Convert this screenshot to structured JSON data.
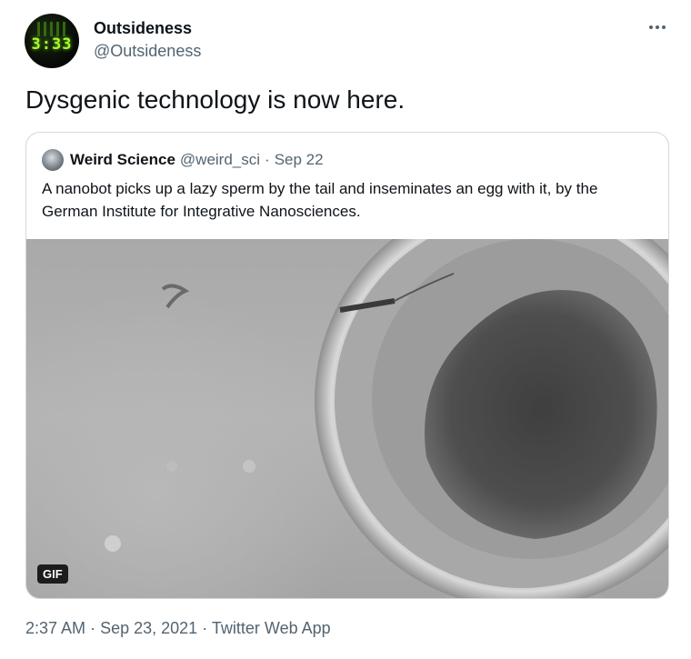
{
  "author": {
    "display_name": "Outsideness",
    "handle": "@Outsideness",
    "avatar_text": "3:33"
  },
  "tweet": {
    "text": "Dysgenic technology is now here."
  },
  "quoted_tweet": {
    "display_name": "Weird Science",
    "handle": "@weird_sci",
    "separator": "·",
    "date": "Sep 22",
    "text": "A nanobot picks up a lazy sperm by the tail and inseminates an egg with it, by the German Institute for Integrative Nanosciences.",
    "media_badge": "GIF"
  },
  "footer": {
    "time": "2:37 AM",
    "separator": "·",
    "date": "Sep 23, 2021",
    "source": "Twitter Web App"
  },
  "icons": {
    "more": "more-horizontal-icon"
  }
}
